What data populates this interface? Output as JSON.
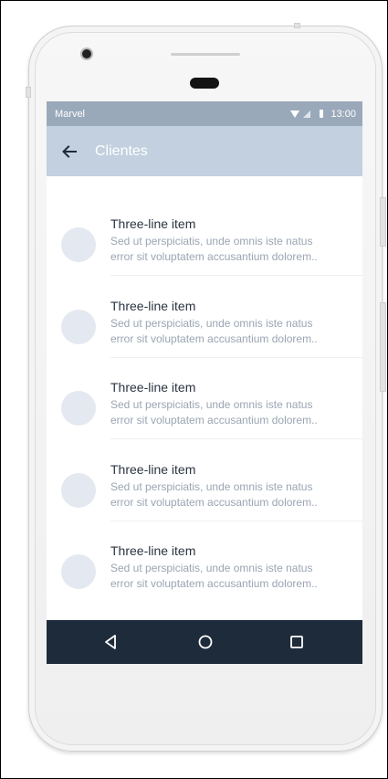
{
  "status_bar": {
    "carrier": "Marvel",
    "time": "13:00"
  },
  "app_bar": {
    "title": "Clientes",
    "back_icon": "arrow-left-icon"
  },
  "list": {
    "items": [
      {
        "title": "Three-line item",
        "line1": "Sed ut perspiciatis, unde omnis iste natus",
        "line2": "error sit voluptatem accusantium dolorem.."
      },
      {
        "title": "Three-line item",
        "line1": "Sed ut perspiciatis, unde omnis iste natus",
        "line2": "error sit voluptatem accusantium dolorem.."
      },
      {
        "title": "Three-line item",
        "line1": "Sed ut perspiciatis, unde omnis iste natus",
        "line2": "error sit voluptatem accusantium dolorem.."
      },
      {
        "title": "Three-line item",
        "line1": "Sed ut perspiciatis, unde omnis iste natus",
        "line2": "error sit voluptatem accusantium dolorem.."
      },
      {
        "title": "Three-line item",
        "line1": "Sed ut perspiciatis, unde omnis iste natus",
        "line2": "error sit voluptatem accusantium dolorem.."
      }
    ]
  },
  "nav_bar": {
    "back_icon": "triangle-back-icon",
    "home_icon": "circle-home-icon",
    "recents_icon": "square-recents-icon"
  },
  "colors": {
    "status_bar": "#9aa9ba",
    "app_bar": "#c2d0df",
    "nav_bar": "#1e2b3a",
    "avatar": "#e4e8f0",
    "title_text": "#2b3441",
    "secondary_text": "#9aa5b3"
  }
}
